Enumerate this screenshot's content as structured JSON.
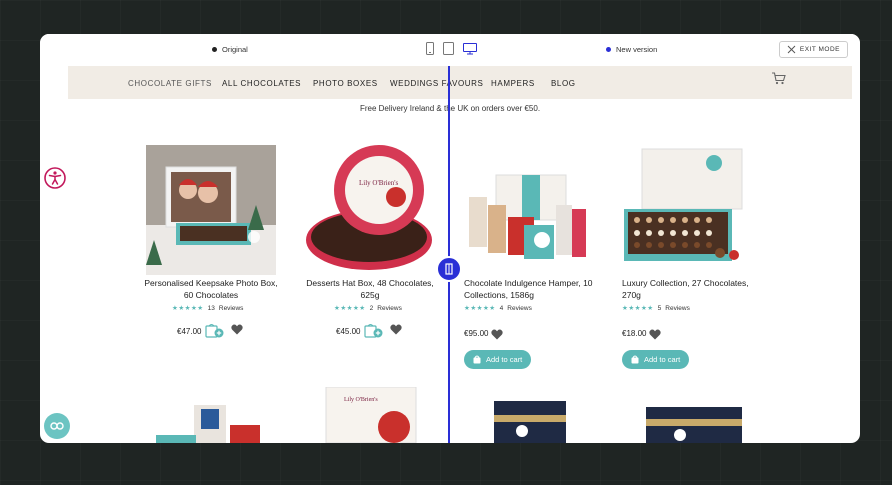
{
  "topbar": {
    "original_label": "Original",
    "new_label": "New version",
    "exit_label": "EXIT MODE",
    "accent": "#2a2fd6"
  },
  "nav": {
    "items": [
      "CHOCOLATE GIFTS",
      "ALL CHOCOLATES",
      "PHOTO BOXES",
      "WEDDINGS FAVOURS",
      "HAMPERS",
      "BLOG"
    ]
  },
  "promo": "Free Delivery Ireland & the UK on orders over €50.",
  "products": [
    {
      "name": "Personalised Keepsake Photo Box, 60 Chocolates",
      "stars": "★★★★★",
      "reviews": "13",
      "reviews_label": "Reviews",
      "price": "€47.00"
    },
    {
      "name": "Desserts Hat Box, 48 Chocolates, 625g",
      "stars": "★★★★★",
      "reviews": "2",
      "reviews_label": "Reviews",
      "price": "€45.00"
    },
    {
      "name": "Chocolate Indulgence Hamper, 10 Collections, 1586g",
      "stars": "★★★★★",
      "reviews": "4",
      "reviews_label": "Reviews",
      "price": "€95.00",
      "button": "Add to cart"
    },
    {
      "name": "Luxury Collection, 27 Chocolates, 270g",
      "stars": "★★★★★",
      "reviews": "5",
      "reviews_label": "Reviews",
      "price": "€18.00",
      "button": "Add to cart"
    }
  ],
  "colors": {
    "teal": "#5ab8b6",
    "nav_bg": "#f1ece5",
    "divider": "#2a2fd6",
    "accessibility": "#c2185b"
  }
}
